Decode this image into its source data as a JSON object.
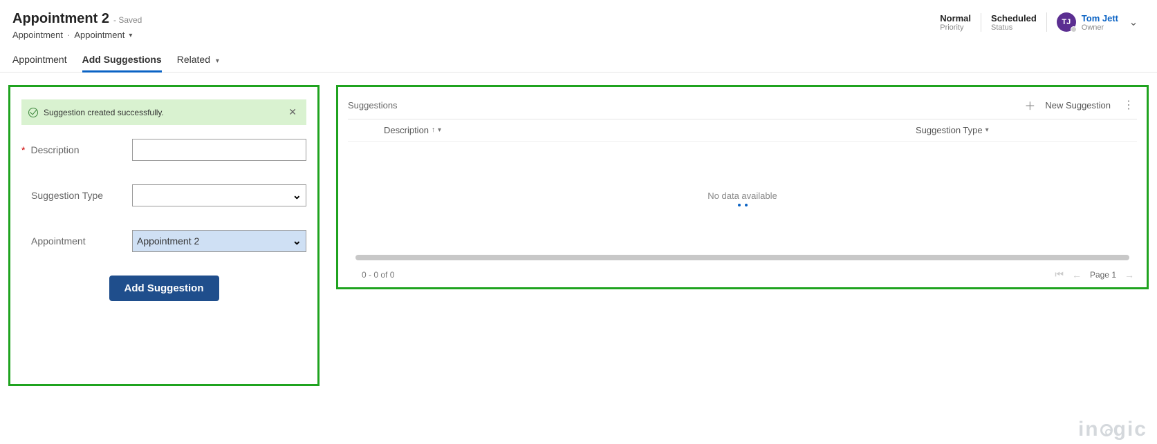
{
  "header": {
    "title": "Appointment 2",
    "save_state": "- Saved",
    "breadcrumb_1": "Appointment",
    "breadcrumb_2": "Appointment",
    "priority_value": "Normal",
    "priority_label": "Priority",
    "status_value": "Scheduled",
    "status_label": "Status",
    "owner_initials": "TJ",
    "owner_name": "Tom Jett",
    "owner_label": "Owner"
  },
  "tabs": {
    "t1": "Appointment",
    "t2": "Add Suggestions",
    "t3": "Related"
  },
  "banner": {
    "text": "Suggestion created successfully."
  },
  "form": {
    "desc_label": "Description",
    "desc_value": "",
    "type_label": "Suggestion Type",
    "type_value": "",
    "appt_label": "Appointment",
    "appt_value": "Appointment 2",
    "submit": "Add Suggestion"
  },
  "grid": {
    "title": "Suggestions",
    "new_label": "New Suggestion",
    "col_description": "Description",
    "col_type": "Suggestion Type",
    "empty": "No data available",
    "count": "0 - 0 of 0",
    "page": "Page 1"
  },
  "watermark": "in   gic"
}
